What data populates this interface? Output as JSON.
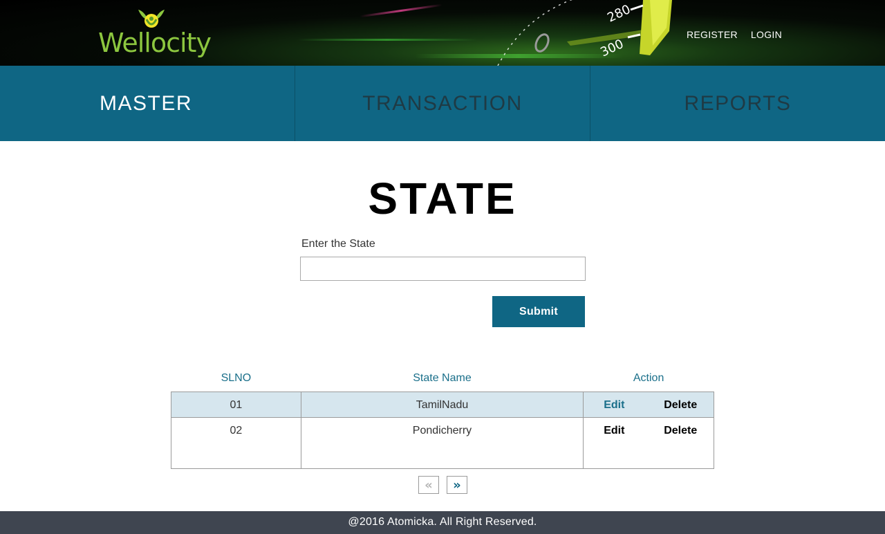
{
  "header": {
    "logo_text": "Wellocity",
    "speedometer_marks": [
      "280",
      "300"
    ],
    "links": {
      "register": "REGISTER",
      "login": "LOGIN"
    }
  },
  "nav": {
    "items": [
      {
        "label": "MASTER",
        "active": true
      },
      {
        "label": "TRANSACTION",
        "active": false
      },
      {
        "label": "REPORTS",
        "active": false
      }
    ]
  },
  "page": {
    "title": "STATE",
    "field_label": "Enter the State",
    "input_value": "",
    "submit_label": "Submit"
  },
  "table": {
    "headers": {
      "slno": "SLNO",
      "state_name": "State Name",
      "action": "Action"
    },
    "rows": [
      {
        "slno": "01",
        "state_name": "TamilNadu",
        "edit": "Edit",
        "delete": "Delete"
      },
      {
        "slno": "02",
        "state_name": "Pondicherry",
        "edit": "Edit",
        "delete": "Delete"
      }
    ]
  },
  "pager": {
    "prev": "«",
    "next": "»"
  },
  "footer": {
    "text": "@2016 Atomicka. All Right Reserved."
  },
  "colors": {
    "nav_bg": "#0f6684",
    "accent": "#1a6f8a",
    "row_highlight": "#d6e6ee",
    "footer_bg": "#3f4550",
    "logo_green": "#8cc63f"
  }
}
